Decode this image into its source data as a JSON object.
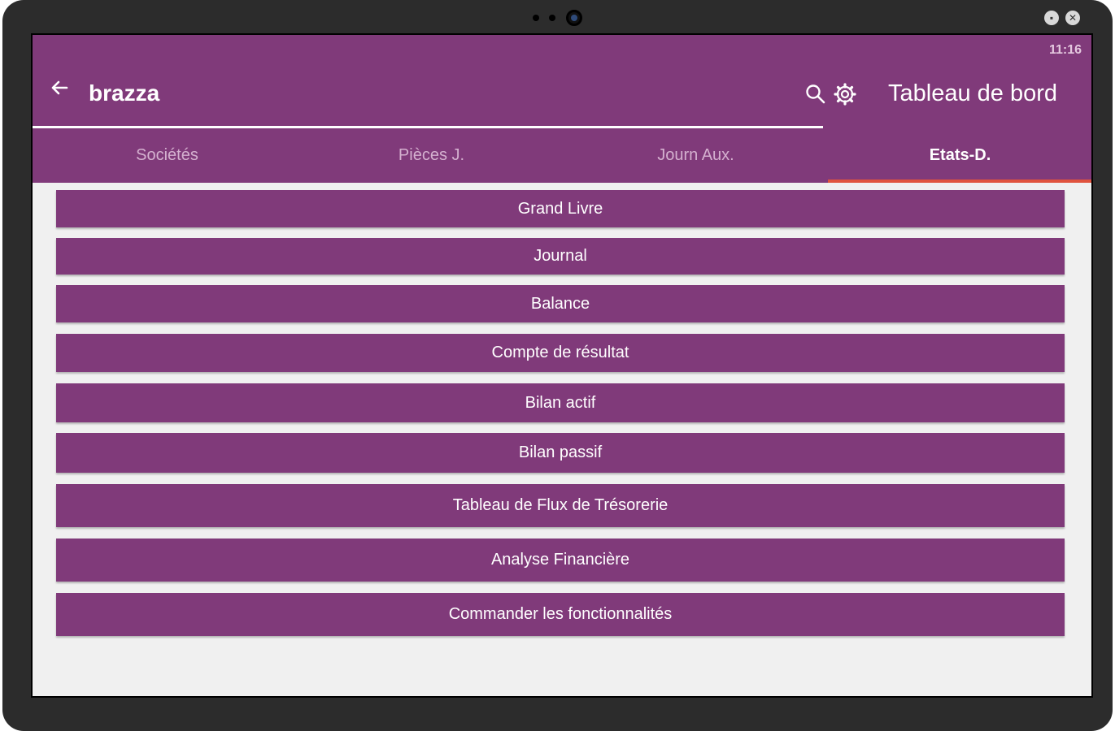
{
  "status_bar": {
    "time": "11:16"
  },
  "app_bar": {
    "title": "brazza",
    "right_title": "Tableau de bord",
    "icons": [
      "back-arrow-icon",
      "search-icon",
      "gear-icon"
    ]
  },
  "tabs": [
    {
      "label": "Sociétés",
      "active": false
    },
    {
      "label": "Pièces J.",
      "active": false
    },
    {
      "label": "Journ Aux.",
      "active": false
    },
    {
      "label": "Etats-D.",
      "active": true
    }
  ],
  "menu": [
    {
      "label": "Grand Livre"
    },
    {
      "label": "Journal"
    },
    {
      "label": "Balance"
    },
    {
      "label": "Compte de résultat"
    },
    {
      "label": "Bilan actif"
    },
    {
      "label": "Bilan passif"
    },
    {
      "label": "Tableau de Flux de Trésorerie"
    },
    {
      "label": "Analyse Financière"
    },
    {
      "label": "Commander les fonctionnalités"
    }
  ],
  "colors": {
    "primary": "#803a7a",
    "accent": "#e0533e",
    "background": "#f0f0f0"
  }
}
